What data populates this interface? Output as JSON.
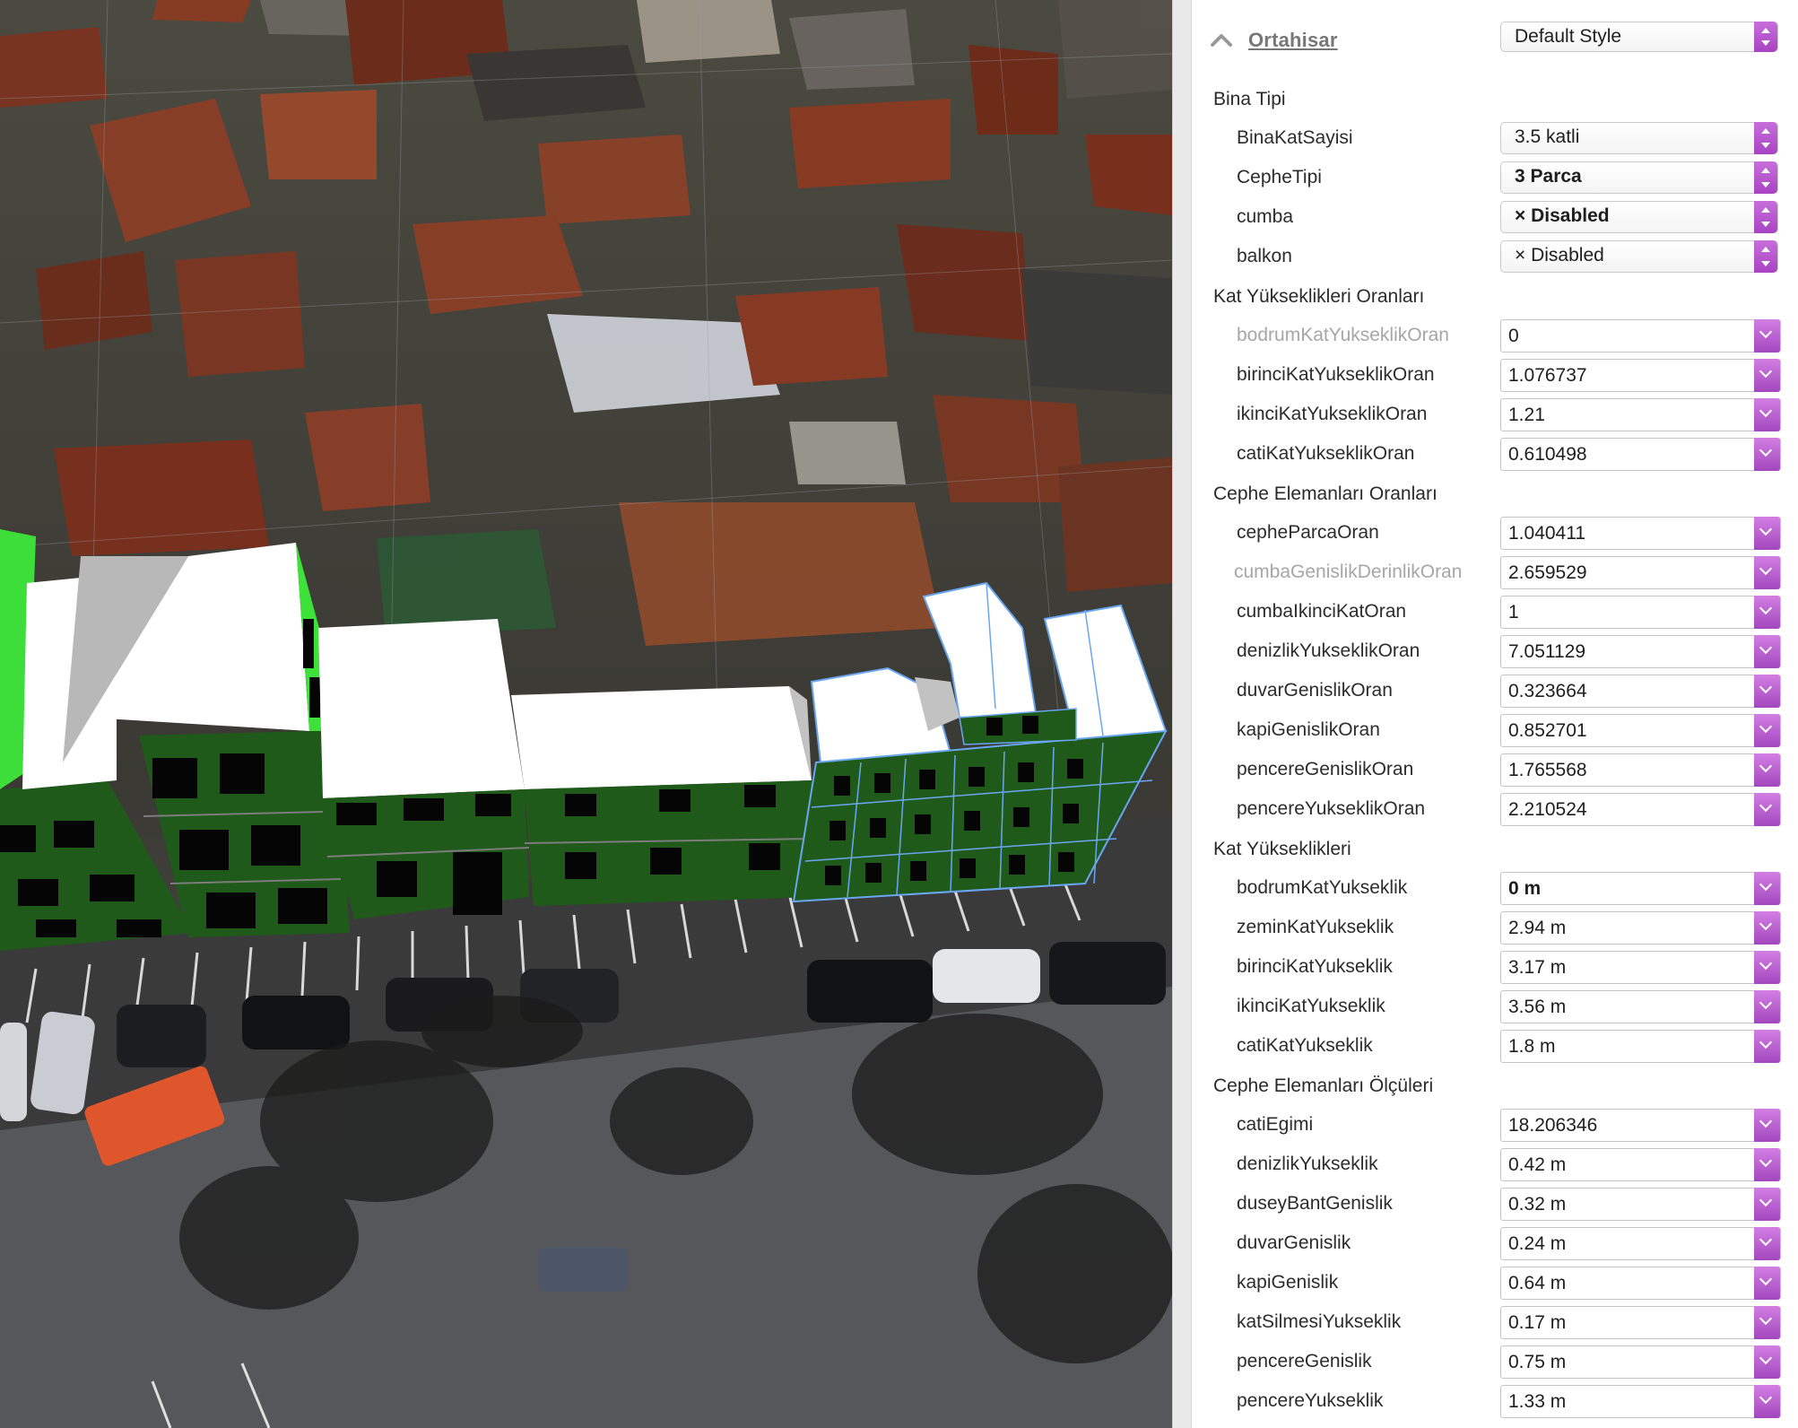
{
  "inspector": {
    "title": "Ortahisar",
    "style": "Default Style",
    "groups": [
      {
        "label": "Bina Tipi",
        "rows": [
          {
            "label": "BinaKatSayisi",
            "value": "3.5 katli"
          },
          {
            "label": "CepheTipi",
            "value": "3 Parca"
          },
          {
            "label": "cumba",
            "value": "× Disabled"
          },
          {
            "label": "balkon",
            "value": "× Disabled"
          }
        ]
      },
      {
        "label": "Kat Yükseklikleri Oranları",
        "rows": [
          {
            "label": "bodrumKatYukseklikOran",
            "value": "0"
          },
          {
            "label": "birinciKatYukseklikOran",
            "value": "1.076737"
          },
          {
            "label": "ikinciKatYukseklikOran",
            "value": "1.21"
          },
          {
            "label": "catiKatYukseklikOran",
            "value": "0.610498"
          }
        ]
      },
      {
        "label": "Cephe Elemanları Oranları",
        "rows": [
          {
            "label": "cepheParcaOran",
            "value": "1.040411"
          },
          {
            "label": "cumbaGenislikDerinlikOran",
            "value": "2.659529"
          },
          {
            "label": "cumbaIkinciKatOran",
            "value": "1"
          },
          {
            "label": "denizlikYukseklikOran",
            "value": "7.051129"
          },
          {
            "label": "duvarGenislikOran",
            "value": "0.323664"
          },
          {
            "label": "kapiGenislikOran",
            "value": "0.852701"
          },
          {
            "label": "pencereGenislikOran",
            "value": "1.765568"
          },
          {
            "label": "pencereYukseklikOran",
            "value": "2.210524"
          }
        ]
      },
      {
        "label": "Kat Yükseklikleri",
        "rows": [
          {
            "label": "bodrumKatYukseklik",
            "value": "0 m"
          },
          {
            "label": "zeminKatYukseklik",
            "value": "2.94 m"
          },
          {
            "label": "birinciKatYukseklik",
            "value": "3.17 m"
          },
          {
            "label": "ikinciKatYukseklik",
            "value": "3.56 m"
          },
          {
            "label": "catiKatYukseklik",
            "value": "1.8 m"
          }
        ]
      },
      {
        "label": "Cephe Elemanları Ölçüleri",
        "rows": [
          {
            "label": "catiEgimi",
            "value": "18.206346"
          },
          {
            "label": "denizlikYukseklik",
            "value": "0.42 m"
          },
          {
            "label": "duseyBantGenislik",
            "value": "0.32 m"
          },
          {
            "label": "duvarGenislik",
            "value": "0.24 m"
          },
          {
            "label": "kapiGenislik",
            "value": "0.64 m"
          },
          {
            "label": "katSilmesiYukseklik",
            "value": "0.17 m"
          },
          {
            "label": "pencereGenislik",
            "value": "0.75 m"
          },
          {
            "label": "pencereYukseklik",
            "value": "1.33 m"
          }
        ]
      }
    ]
  },
  "colors": {
    "accent": "#b452cc",
    "facade": "#1f5a1a",
    "facade_edge": "#3ee03a",
    "roof": "#ffffff",
    "selection": "#6aa6f0"
  }
}
